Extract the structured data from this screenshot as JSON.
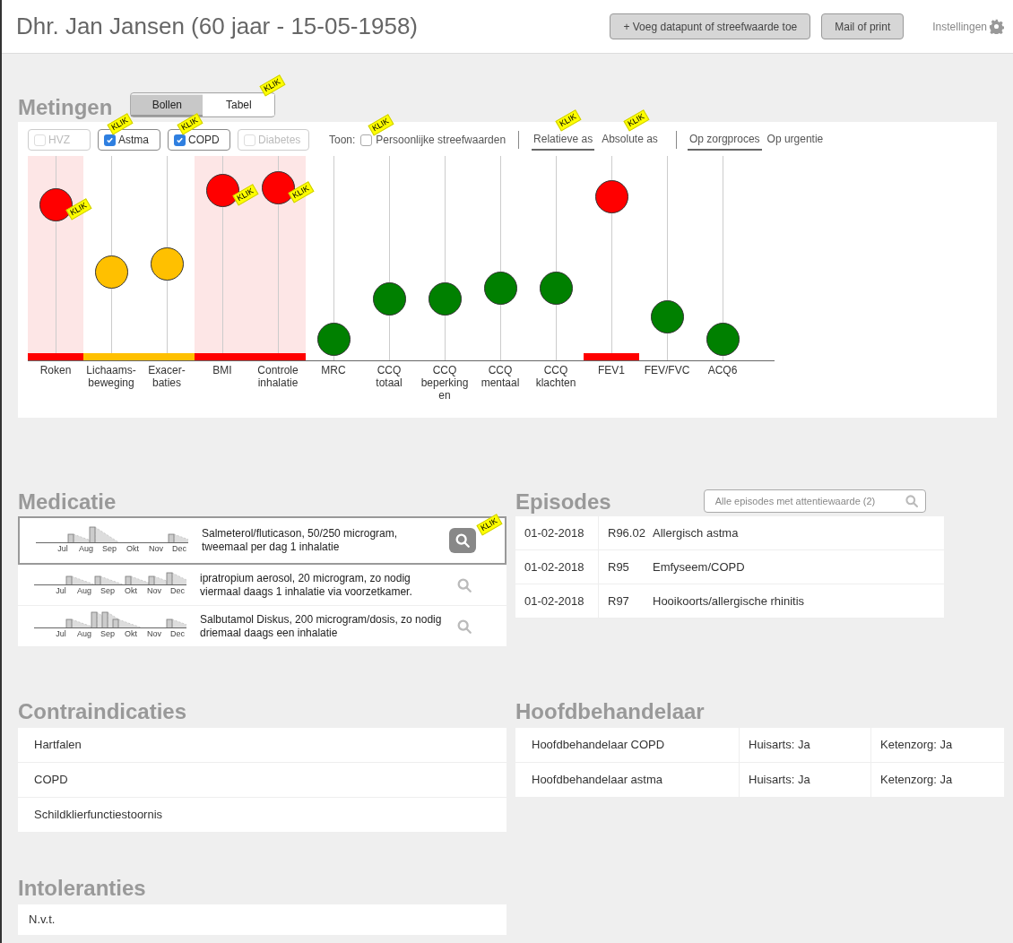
{
  "header": {
    "title": "Dhr. Jan Jansen (60 jaar - 15-05-1958)",
    "buttons": [
      "+ Voeg datapunt of streefwaarde toe",
      "Mail of print"
    ],
    "settings": "Instellingen"
  },
  "metingen": {
    "title": "Metingen",
    "view_tabs": [
      {
        "label": "Bollen",
        "selected": true
      },
      {
        "label": "Tabel",
        "selected": false,
        "klik": "KLIK"
      }
    ],
    "filters": [
      {
        "label": "HVZ",
        "checked": false
      },
      {
        "label": "Astma",
        "checked": true,
        "klik": "KLIK"
      },
      {
        "label": "COPD",
        "checked": true,
        "klik": "KLIK"
      },
      {
        "label": "Diabetes",
        "checked": false
      }
    ],
    "toon": {
      "label": "Toon:",
      "option": "Persoonlijke streefwaarden",
      "checked": false,
      "klik": "KLIK"
    },
    "axis_tabs": [
      {
        "label": "Relatieve as",
        "selected": true,
        "klik": "KLIK"
      },
      {
        "label": "Absolute as",
        "selected": false,
        "klik": "KLIK"
      }
    ],
    "order_tabs": [
      {
        "label": "Op zorgproces",
        "selected": true
      },
      {
        "label": "Op urgentie",
        "selected": false
      }
    ],
    "metrics": [
      {
        "label": "Roken",
        "color": "#ff0000",
        "level": 0.76,
        "shaded": true,
        "flag": {
          "color": "#ff0000"
        },
        "klik": "KLIK"
      },
      {
        "label": "Lichaams-\nbeweging",
        "color": "#ffc000",
        "level": 0.43,
        "shaded": false,
        "flag": {
          "color": "#ffc000"
        }
      },
      {
        "label": "Exacer-\nbaties",
        "color": "#ffc000",
        "level": 0.47,
        "shaded": false,
        "flag": {
          "color": "#ffc000"
        }
      },
      {
        "label": "BMI",
        "color": "#ff0000",
        "level": 0.83,
        "shaded": true,
        "flag": {
          "color": "#ff0000"
        },
        "klik": "KLIK"
      },
      {
        "label": "Controle\ninhalatie",
        "color": "#ff0000",
        "level": 0.84,
        "shaded": true,
        "flag": {
          "color": "#ff0000"
        },
        "klik": "KLIK"
      },
      {
        "label": "MRC",
        "color": "#008000",
        "level": 0.1,
        "shaded": false
      },
      {
        "label": "CCQ\ntotaal",
        "color": "#008000",
        "level": 0.3,
        "shaded": false
      },
      {
        "label": "CCQ\nbeperking\nen",
        "color": "#008000",
        "level": 0.3,
        "shaded": false
      },
      {
        "label": "CCQ\nmentaal",
        "color": "#008000",
        "level": 0.35,
        "shaded": false
      },
      {
        "label": "CCQ\nklachten",
        "color": "#008000",
        "level": 0.35,
        "shaded": false
      },
      {
        "label": "FEV1",
        "color": "#ff0000",
        "level": 0.8,
        "shaded": false,
        "flag": {
          "color": "#ff0000"
        }
      },
      {
        "label": "FEV/FVC",
        "color": "#008000",
        "level": 0.21,
        "shaded": false
      },
      {
        "label": "ACQ6",
        "color": "#008000",
        "level": 0.1,
        "shaded": false
      }
    ]
  },
  "medicatie": {
    "title": "Medicatie",
    "items": [
      {
        "text": "Salmeterol/fluticason, 50/250 microgram, tweemaal per dag 1 inhalatie",
        "months": [
          "Jul",
          "Aug",
          "Sep",
          "Okt",
          "Nov",
          "Dec"
        ],
        "selected": true,
        "klik": "KLIK"
      },
      {
        "text": "ipratropium aerosol, 20 microgram, zo nodig viermaal daags 1 inhalatie via voorzetkamer.",
        "months": [
          "Jul",
          "Aug",
          "Sep",
          "Okt",
          "Nov",
          "Dec"
        ],
        "selected": false
      },
      {
        "text": "Salbutamol Diskus, 200 microgram/dosis, zo nodig driemaal daags een inhalatie",
        "months": [
          "Jul",
          "Aug",
          "Sep",
          "Okt",
          "Nov",
          "Dec"
        ],
        "selected": false
      }
    ]
  },
  "episodes": {
    "title": "Episodes",
    "search": {
      "placeholder": "Alle episodes met attentiewaarde (2)"
    },
    "rows": [
      {
        "date": "01-02-2018",
        "code": "R96.02",
        "description": "Allergisch astma"
      },
      {
        "date": "01-02-2018",
        "code": "R95",
        "description": "Emfyseem/COPD"
      },
      {
        "date": "01-02-2018",
        "code": "R97",
        "description": "Hooikoorts/allergische rhinitis"
      }
    ]
  },
  "contraindicaties": {
    "title": "Contraindicaties",
    "items": [
      "Hartfalen",
      "COPD",
      "Schildklierfunctiestoornis"
    ]
  },
  "hoofdbehandelaar": {
    "title": "Hoofdbehandelaar",
    "rows": [
      {
        "role": "Hoofdbehandelaar COPD",
        "huisarts": "Huisarts: Ja",
        "ketenzorg": "Ketenzorg: Ja"
      },
      {
        "role": "Hoofdbehandelaar astma",
        "huisarts": "Huisarts: Ja",
        "ketenzorg": "Ketenzorg: Ja"
      }
    ]
  },
  "intoleranties": {
    "title": "Intoleranties",
    "items": [
      "N.v.t."
    ]
  }
}
